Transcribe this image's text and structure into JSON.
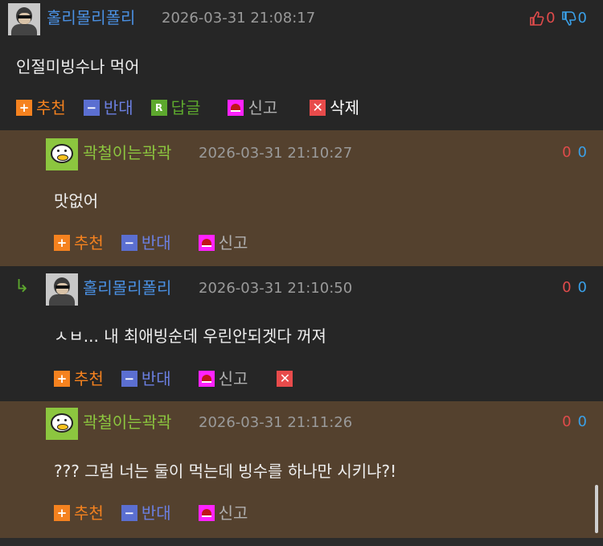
{
  "comments": [
    {
      "nick": "홀리몰리폴리",
      "date": "2026-03-31 21:08:17",
      "text": "인절미빙수나 먹어",
      "up": "0",
      "down": "0",
      "actions": {
        "recommend": "추천",
        "oppose": "반대",
        "reply": "답글",
        "report": "신고",
        "delete": "삭제"
      }
    },
    {
      "nick": "곽철이는곽곽",
      "date": "2026-03-31 21:10:27",
      "text": "맛없어",
      "up": "0",
      "down": "0",
      "actions": {
        "recommend": "추천",
        "oppose": "반대",
        "report": "신고"
      }
    },
    {
      "nick": "홀리몰리폴리",
      "date": "2026-03-31 21:10:50",
      "text": "ㅅㅂ... 내 최애빙순데 우린안되겟다 꺼져",
      "up": "0",
      "down": "0",
      "actions": {
        "recommend": "추천",
        "oppose": "반대",
        "report": "신고"
      }
    },
    {
      "nick": "곽철이는곽곽",
      "date": "2026-03-31 21:11:26",
      "text": "??? 그럼 너는 둘이 먹는데 빙수를 하나만 시키냐?!",
      "up": "0",
      "down": "0",
      "actions": {
        "recommend": "추천",
        "oppose": "반대",
        "report": "신고"
      }
    }
  ],
  "icons": {
    "recommend": "+",
    "oppose": "−",
    "reply": "R",
    "delete": "✕",
    "reply_arrow": "↳"
  },
  "colors": {
    "dark_bg": "#262626",
    "reply_bg": "#54412e",
    "nick_blue": "#4a90e2",
    "nick_green": "#8cc63f",
    "up": "#e04b4b",
    "down": "#3aa0e8"
  }
}
